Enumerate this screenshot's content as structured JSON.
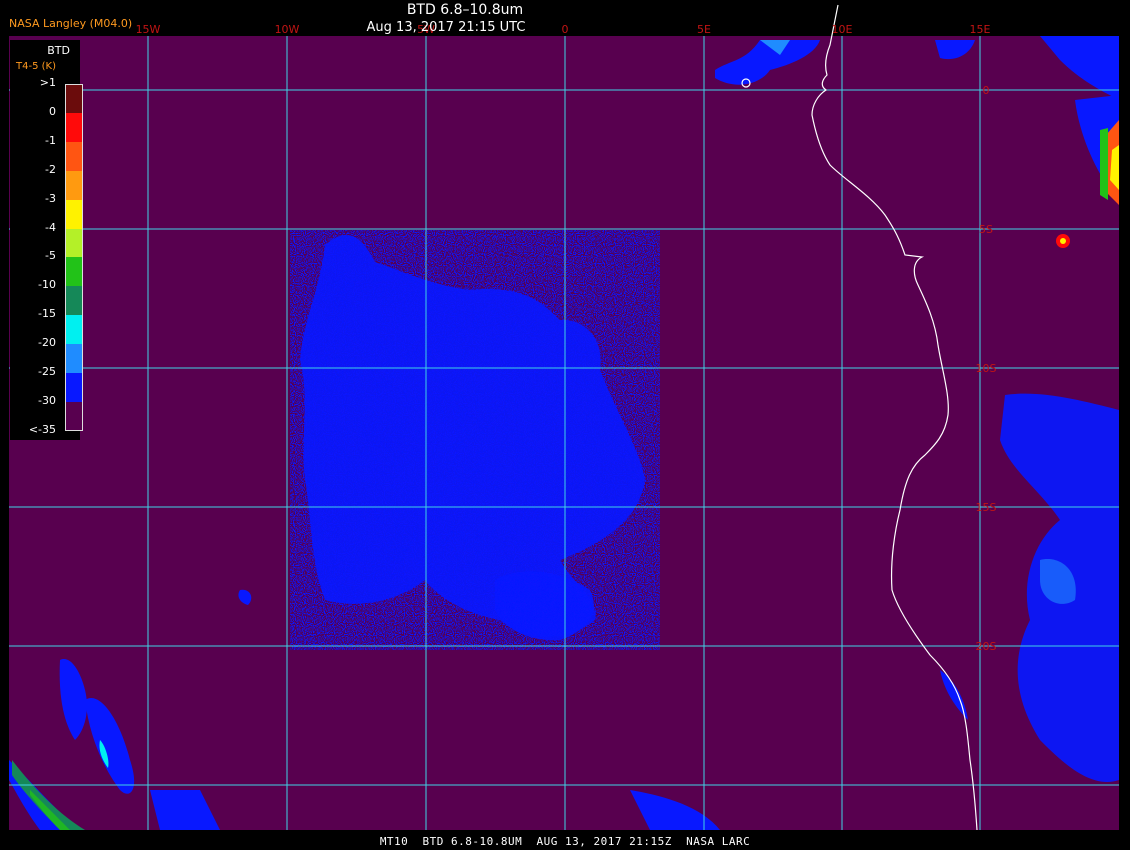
{
  "header": {
    "product": "BTD 6.8–10.8um",
    "datetime": "Aug 13, 2017 21:15 UTC",
    "credit": "NASA Langley (M04.0)"
  },
  "footer": {
    "text": "MT10  BTD 6.8-10.8UM  AUG 13, 2017 21:15Z  NASA LARC"
  },
  "legend": {
    "title": "BTD",
    "subtitle": "T4-5 (K)",
    "labels": [
      ">1",
      "0",
      "-1",
      "-2",
      "-3",
      "-4",
      "-5",
      "-10",
      "-15",
      "-20",
      "-25",
      "-30",
      "<-35"
    ],
    "colors": [
      "#6b0c0c",
      "#ff0a0a",
      "#ff5512",
      "#ff9a10",
      "#fff200",
      "#b4f028",
      "#22c218",
      "#158858",
      "#00f0f0",
      "#1f8cff",
      "#0818ff",
      "#58004f"
    ]
  },
  "map": {
    "background_color": "#58004f",
    "grid_color": "#3fd3e6",
    "coast_color": "#ffffff",
    "lon_labels": [
      "15W",
      "10W",
      "5W",
      "0",
      "5E",
      "10E",
      "15E"
    ],
    "lat_labels": [
      "0",
      "5S",
      "10S",
      "15S",
      "20S"
    ],
    "label_color": "#c21414"
  }
}
